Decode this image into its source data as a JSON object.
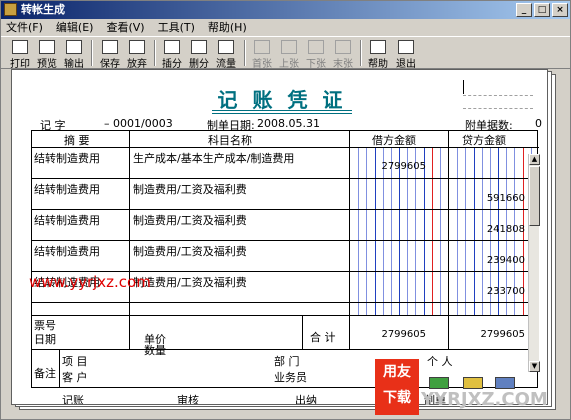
{
  "window": {
    "title": "转帐生成"
  },
  "menu": [
    "文件(F)",
    "编辑(E)",
    "查看(V)",
    "工具(T)",
    "帮助(H)"
  ],
  "toolbar": [
    {
      "label": "打印",
      "icon": "print-icon",
      "enabled": true
    },
    {
      "label": "预览",
      "icon": "preview-icon",
      "enabled": true
    },
    {
      "label": "输出",
      "icon": "export-icon",
      "enabled": true
    },
    {
      "label": "保存",
      "icon": "save-icon",
      "enabled": true
    },
    {
      "label": "放弃",
      "icon": "discard-icon",
      "enabled": true
    },
    {
      "label": "插分",
      "icon": "insert-row-icon",
      "enabled": true
    },
    {
      "label": "删分",
      "icon": "delete-row-icon",
      "enabled": true
    },
    {
      "label": "流量",
      "icon": "cashflow-icon",
      "enabled": true
    },
    {
      "label": "首张",
      "icon": "first-icon",
      "enabled": false
    },
    {
      "label": "上张",
      "icon": "prev-icon",
      "enabled": false
    },
    {
      "label": "下张",
      "icon": "next-icon",
      "enabled": false
    },
    {
      "label": "末张",
      "icon": "last-icon",
      "enabled": false
    },
    {
      "label": "帮助",
      "icon": "help-icon",
      "enabled": true
    },
    {
      "label": "退出",
      "icon": "exit-icon",
      "enabled": true
    }
  ],
  "voucher": {
    "title": "记 账 凭 证",
    "type_label": "记 字",
    "number": "– 0001/0003",
    "date_label": "制单日期:",
    "date": "2008.05.31",
    "attachments_label": "附单据数:",
    "attachments": "0",
    "columns": {
      "summary": "摘 要",
      "account": "科目名称",
      "debit": "借方金额",
      "credit": "贷方金额"
    },
    "rows": [
      {
        "summary": "结转制造费用",
        "account": "生产成本/基本生产成本/制造费用",
        "debit": "2799605",
        "credit": ""
      },
      {
        "summary": "结转制造费用",
        "account": "制造费用/工资及福利费",
        "debit": "",
        "credit": "591660"
      },
      {
        "summary": "结转制造费用",
        "account": "制造费用/工资及福利费",
        "debit": "",
        "credit": "241808"
      },
      {
        "summary": "结转制造费用",
        "account": "制造费用/工资及福利费",
        "debit": "",
        "credit": "239400"
      },
      {
        "summary": "结转制造费用",
        "account": "制造费用/工资及福利费",
        "debit": "",
        "credit": "233700"
      }
    ],
    "ticket_label": "票号",
    "ticket_date_label": "日期",
    "unit_price_label": "单价",
    "quantity_label": "数量",
    "total_label": "合 计",
    "total_debit": "2799605",
    "total_credit": "2799605",
    "remark_label": "备注",
    "project_label": "项  目",
    "customer_label": "客  户",
    "dept_label": "部  门",
    "person_label": "个  人",
    "salesman_label": "业务员",
    "sig": {
      "bookkeep": "记账",
      "audit": "审核",
      "cashier": "出纳",
      "maker": "制单"
    }
  },
  "watermark": "www.yyrjxz.com",
  "logo": {
    "line1": "用友",
    "line2": "下载",
    "text": "YYRJXZ.COM"
  }
}
